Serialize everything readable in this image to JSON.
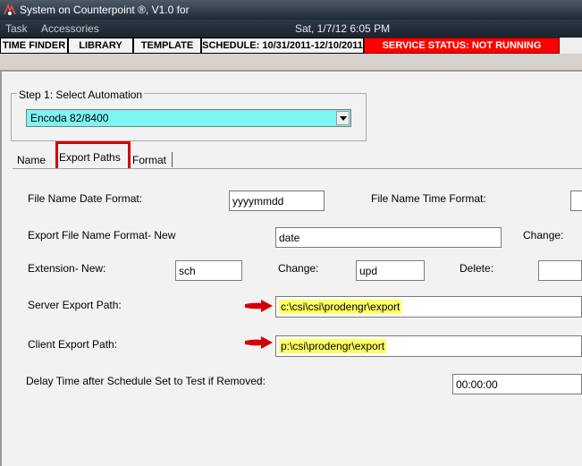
{
  "window": {
    "title": "System on Counterpoint ®, V1.0 for"
  },
  "menu": {
    "items": [
      "Task",
      "Accessories"
    ],
    "date": "Sat, 1/7/12 6:05 PM"
  },
  "toolbar": {
    "time_finder": "TIME FINDER",
    "library": "LIBRARY",
    "template": "TEMPLATE",
    "schedule": "SCHEDULE: 10/31/2011-12/10/2011",
    "service_status": "SERVICE STATUS: NOT RUNNING"
  },
  "step1": {
    "legend": "Step 1: Select Automation",
    "selected": "Encoda 82/8400"
  },
  "tabs": {
    "name": "Name",
    "export_paths": "Export Paths",
    "format": "Format"
  },
  "form": {
    "file_name_date_format_label": "File Name Date Format:",
    "file_name_date_format_value": "yyyymmdd",
    "file_name_time_format_label": "File Name Time Format:",
    "file_name_time_format_value": "",
    "export_file_name_format_label": "Export File Name Format- New",
    "export_file_name_format_value": "date",
    "change_label_1": "Change:",
    "extension_new_label": "Extension- New:",
    "extension_new_value": "sch",
    "extension_change_label": "Change:",
    "extension_change_value": "upd",
    "extension_delete_label": "Delete:",
    "extension_delete_value": "",
    "server_export_path_label": "Server Export Path:",
    "server_export_path_value": "c:\\csi\\csi\\prodengr\\export",
    "client_export_path_label": "Client Export Path:",
    "client_export_path_value": "p:\\csi\\prodengr\\export",
    "delay_label": "Delay Time after Schedule Set to Test if Removed:",
    "delay_value": "00:00:00"
  },
  "colors": {
    "service_status_bg": "#ff0000",
    "selection_bg": "#7ff4f4",
    "highlight": "#ffff66",
    "annotation": "#d40000"
  },
  "icons": [
    "app-icon",
    "chevron-down-icon",
    "red-arrow-icon"
  ]
}
